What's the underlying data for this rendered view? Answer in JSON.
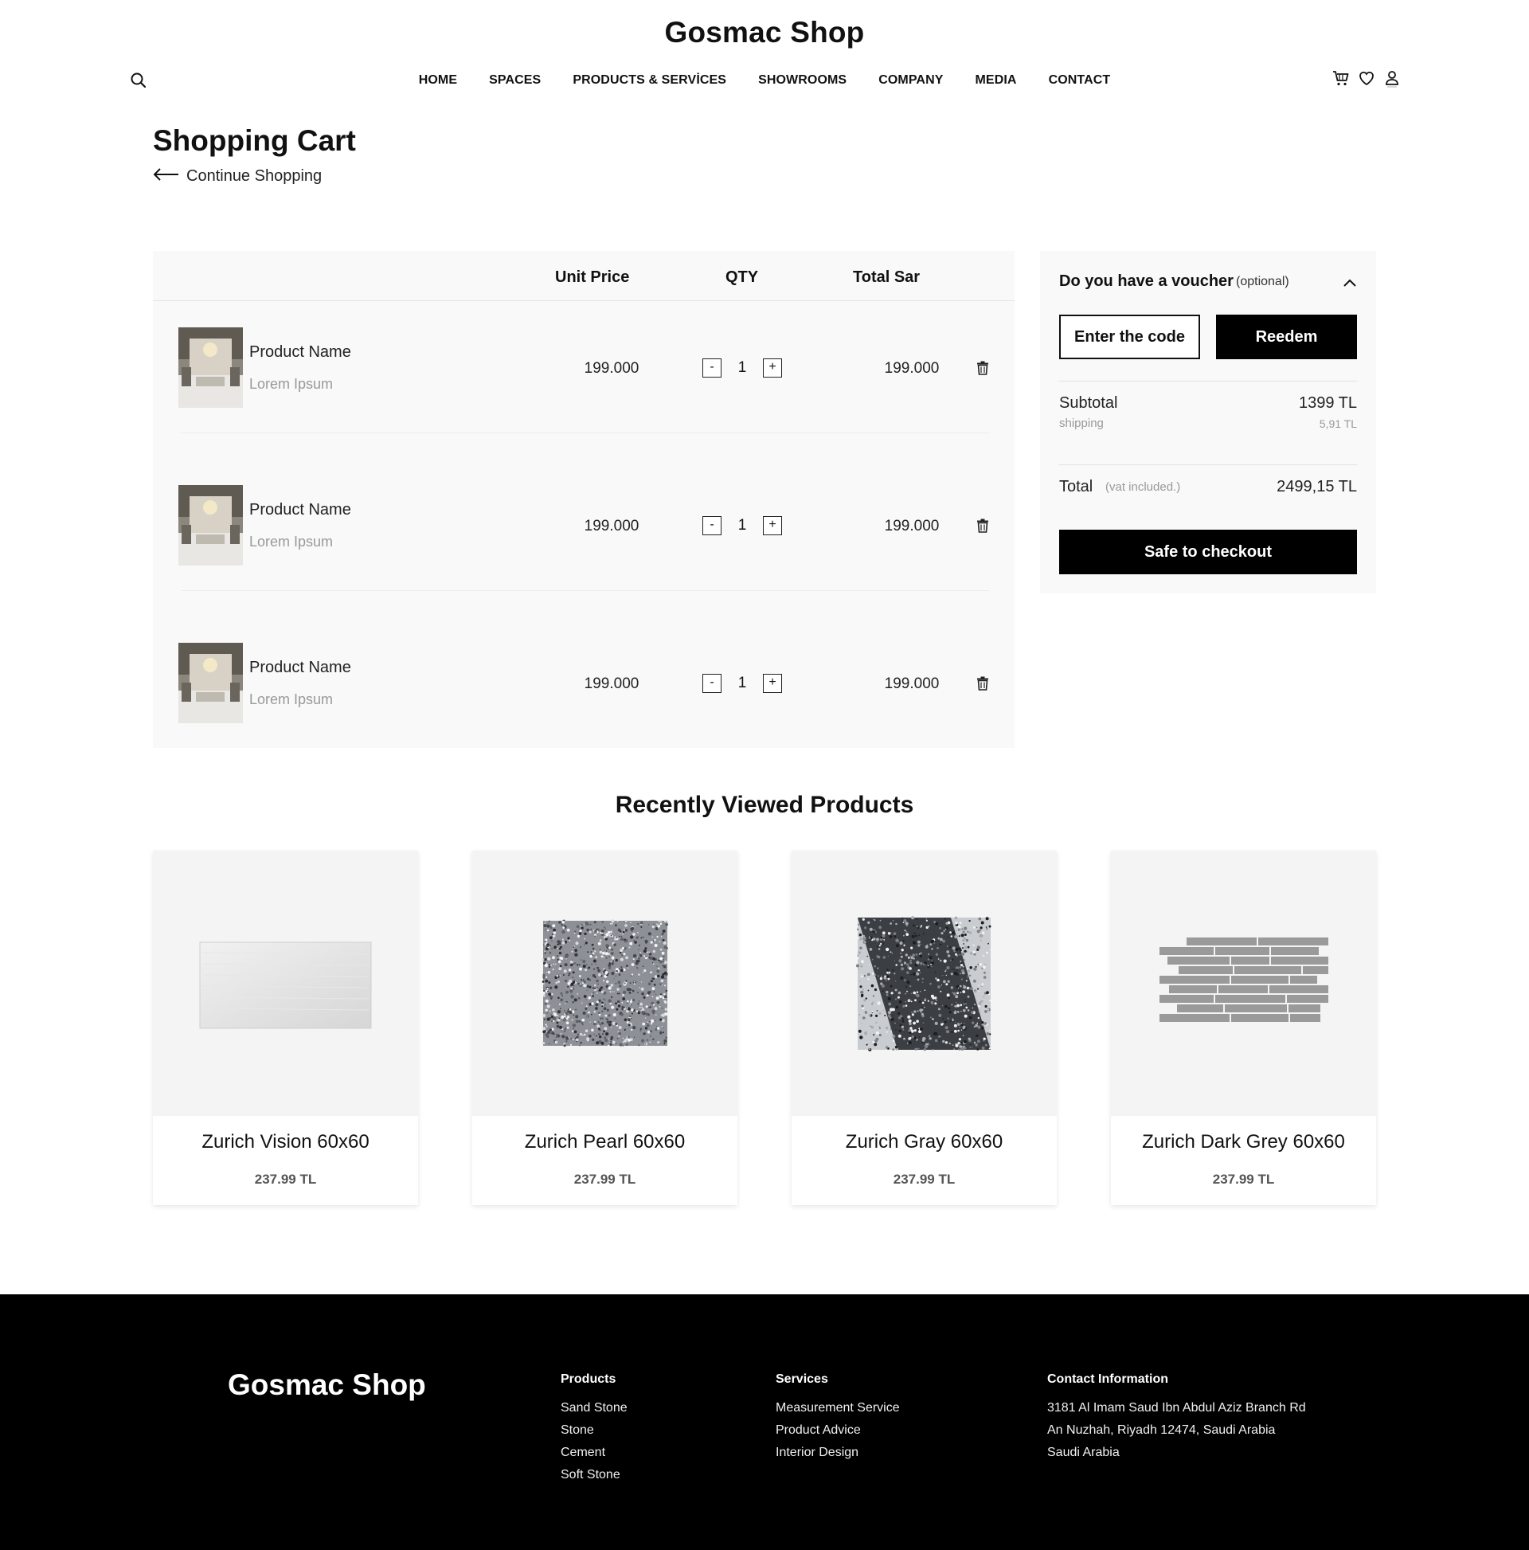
{
  "header": {
    "brand": "Gosmac Shop",
    "nav": [
      "HOME",
      "SPACES",
      "PRODUCTS & SERVİCES",
      "SHOWROOMS",
      "COMPANY",
      "MEDIA",
      "CONTACT"
    ],
    "icons": [
      "search-icon",
      "cart-icon",
      "heart-icon",
      "user-icon"
    ]
  },
  "page": {
    "title": "Shopping Cart",
    "continue_label": "Continue Shopping"
  },
  "cart": {
    "headers": {
      "unit_price": "Unit Price",
      "qty": "QTY",
      "total": "Total Sar"
    },
    "items": [
      {
        "name": "Product Name",
        "subtitle": "Lorem Ipsum",
        "unit_price": "199.000",
        "qty": "1",
        "total": "199.000"
      },
      {
        "name": "Product Name",
        "subtitle": "Lorem Ipsum",
        "unit_price": "199.000",
        "qty": "1",
        "total": "199.000"
      },
      {
        "name": "Product Name",
        "subtitle": "Lorem Ipsum",
        "unit_price": "199.000",
        "qty": "1",
        "total": "199.000"
      }
    ],
    "minus_label": "-",
    "plus_label": "+"
  },
  "summary": {
    "voucher_title": "Do you have a voucher",
    "voucher_optional": "(optional)",
    "code_placeholder": "Enter the code",
    "redeem_label": "Reedem",
    "subtotal_label": "Subtotal",
    "subtotal_value": "1399 TL",
    "shipping_label": "shipping",
    "shipping_value": "5,91 TL",
    "total_label": "Total",
    "vat_label": "(vat included.)",
    "total_value": "2499,15 TL",
    "checkout_label": "Safe to checkout"
  },
  "recent": {
    "title": "Recently Viewed Products",
    "products": [
      {
        "name": "Zurich Vision 60x60",
        "price": "237.99 TL"
      },
      {
        "name": "Zurich Pearl 60x60",
        "price": "237.99 TL"
      },
      {
        "name": "Zurich Gray 60x60",
        "price": "237.99 TL"
      },
      {
        "name": "Zurich Dark Grey 60x60",
        "price": "237.99 TL"
      }
    ]
  },
  "footer": {
    "brand": "Gosmac Shop",
    "products_title": "Products",
    "products": [
      "Sand Stone",
      "Stone",
      "Cement",
      "Soft Stone"
    ],
    "services_title": "Services",
    "services": [
      "Measurement Service",
      "Product Advice",
      "Interior Design"
    ],
    "contact_title": "Contact Information",
    "contact": [
      "3181 Al Imam Saud Ibn Abdul Aziz Branch Rd",
      "An Nuzhah, Riyadh 12474, Saudi Arabia",
      "Saudi Arabia"
    ]
  },
  "colors": {
    "accent": "#000000",
    "panel": "#f9f9f9",
    "muted": "#999999"
  }
}
